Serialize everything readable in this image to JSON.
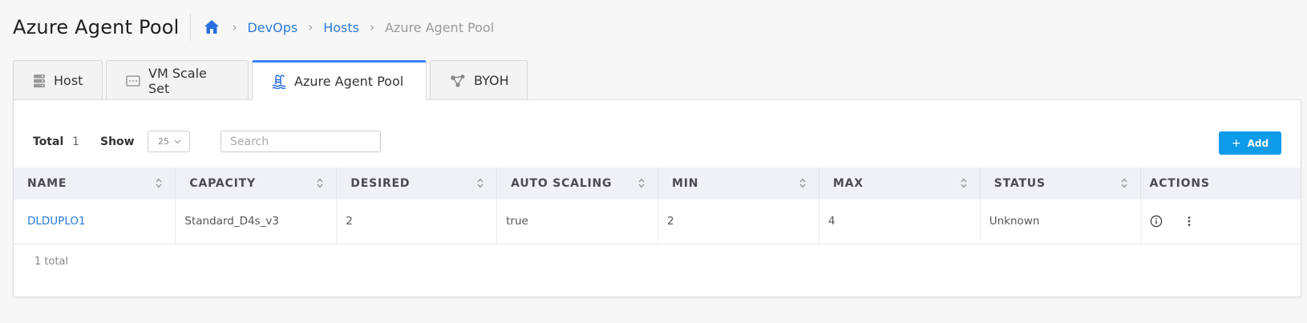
{
  "header": {
    "title": "Azure Agent Pool",
    "breadcrumb": [
      {
        "label": "DevOps"
      },
      {
        "label": "Hosts"
      },
      {
        "label": "Azure Agent Pool"
      }
    ]
  },
  "tabs": [
    {
      "label": "Host",
      "icon": "server-icon"
    },
    {
      "label": "VM Scale Set",
      "icon": "vm-scale-set-icon"
    },
    {
      "label": "Azure Agent Pool",
      "icon": "agent-pool-icon",
      "active": true
    },
    {
      "label": "BYOH",
      "icon": "byoh-icon"
    }
  ],
  "toolbar": {
    "total_label": "Total",
    "total_count": "1",
    "show_label": "Show",
    "show_value": "25",
    "search_placeholder": "Search",
    "add_label": "Add"
  },
  "table": {
    "columns": [
      "NAME",
      "CAPACITY",
      "DESIRED",
      "AUTO SCALING",
      "MIN",
      "MAX",
      "STATUS",
      "ACTIONS"
    ],
    "rows": [
      {
        "name": "DLDUPLO1",
        "capacity": "Standard_D4s_v3",
        "desired": "2",
        "auto_scaling": "true",
        "min": "2",
        "max": "4",
        "status": "Unknown"
      }
    ]
  },
  "footer": {
    "total_text": "1 total"
  },
  "colors": {
    "accent": "#0e9be8",
    "link": "#2a7bd6",
    "active_tab_border": "#3b82f6"
  }
}
